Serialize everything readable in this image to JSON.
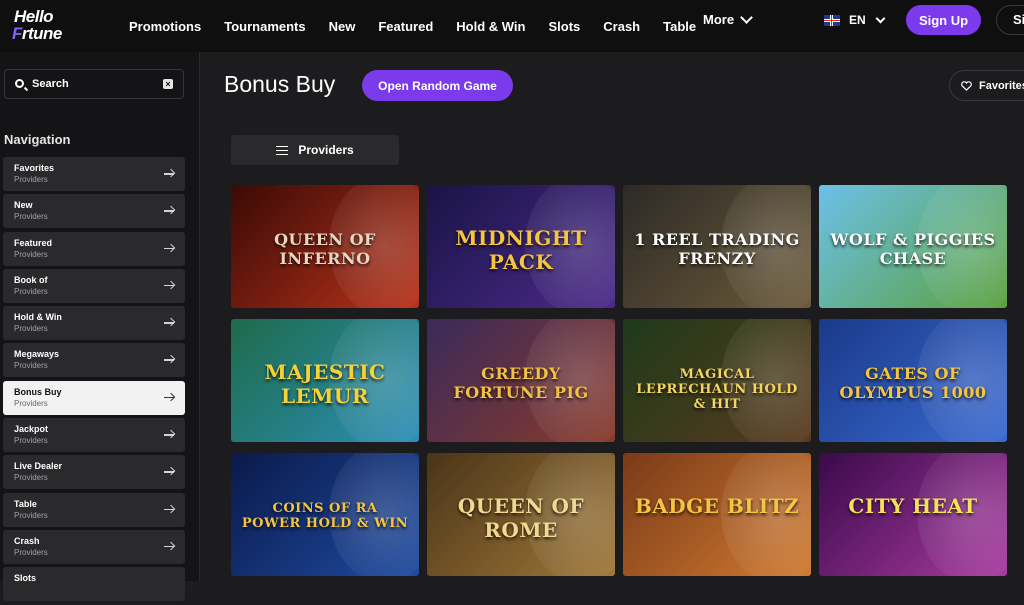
{
  "header": {
    "logo_line1": "Hello",
    "logo_line2_first": "F",
    "logo_line2_rest": "rtune",
    "nav": [
      "Promotions",
      "Tournaments",
      "New",
      "Featured",
      "Hold & Win",
      "Slots",
      "Crash",
      "Table"
    ],
    "more_label": "More",
    "language": "EN",
    "signup_label": "Sign Up",
    "signin_label": "Si"
  },
  "sidebar": {
    "search_placeholder": "Search",
    "clear_icon": "x-icon",
    "nav_title": "Navigation",
    "items": [
      {
        "title": "Favorites",
        "sub": "Providers"
      },
      {
        "title": "New",
        "sub": "Providers"
      },
      {
        "title": "Featured",
        "sub": "Providers"
      },
      {
        "title": "Book of",
        "sub": "Providers"
      },
      {
        "title": "Hold & Win",
        "sub": "Providers"
      },
      {
        "title": "Megaways",
        "sub": "Providers"
      },
      {
        "title": "Bonus Buy",
        "sub": "Providers"
      },
      {
        "title": "Jackpot",
        "sub": "Providers"
      },
      {
        "title": "Live Dealer",
        "sub": "Providers"
      },
      {
        "title": "Table",
        "sub": "Providers"
      },
      {
        "title": "Crash",
        "sub": "Providers"
      },
      {
        "title": "Slots",
        "sub": ""
      }
    ],
    "active_index": 6
  },
  "main": {
    "title": "Bonus Buy",
    "random_button": "Open Random Game",
    "favorites_button": "Favorites",
    "providers_button": "Providers"
  },
  "games": [
    {
      "name": "QUEEN OF INFERNO",
      "colors": [
        "#3a0a06",
        "#b8321a"
      ],
      "text": "#e8d6c0"
    },
    {
      "name": "MIDNIGHT PACK",
      "colors": [
        "#1a1446",
        "#4b2a8a"
      ],
      "text": "#f5c542"
    },
    {
      "name": "1 REEL TRADING FRENZY",
      "colors": [
        "#2d2a26",
        "#6b5a3a"
      ],
      "text": "#ffffff"
    },
    {
      "name": "WOLF & PIGGIES CHASE",
      "colors": [
        "#6cc0e8",
        "#5aa03c"
      ],
      "text": "#ffffff"
    },
    {
      "name": "MAJESTIC LEMUR",
      "colors": [
        "#1e6b4a",
        "#2c8fb8"
      ],
      "text": "#f3d23a"
    },
    {
      "name": "GREEDY FORTUNE PIG",
      "colors": [
        "#3a2a5a",
        "#8a3a2a"
      ],
      "text": "#f2c043"
    },
    {
      "name": "MAGICAL LEPRECHAUN HOLD & HIT",
      "colors": [
        "#1e3a1a",
        "#5a3a1e"
      ],
      "text": "#f5d560"
    },
    {
      "name": "GATES OF OLYMPUS 1000",
      "colors": [
        "#1a3a8a",
        "#3a6ad0"
      ],
      "text": "#f5c542"
    },
    {
      "name": "COINS OF RA POWER HOLD & WIN",
      "colors": [
        "#0a1a4a",
        "#1e4aa0"
      ],
      "text": "#f5c542"
    },
    {
      "name": "QUEEN OF ROME",
      "colors": [
        "#4a3418",
        "#a07838"
      ],
      "text": "#f2d890"
    },
    {
      "name": "BADGE BLITZ",
      "colors": [
        "#7a3a18",
        "#d07a30"
      ],
      "text": "#f5c542"
    },
    {
      "name": "CITY HEAT",
      "colors": [
        "#3a0a4a",
        "#a83aa0"
      ],
      "text": "#f7e05a"
    }
  ]
}
